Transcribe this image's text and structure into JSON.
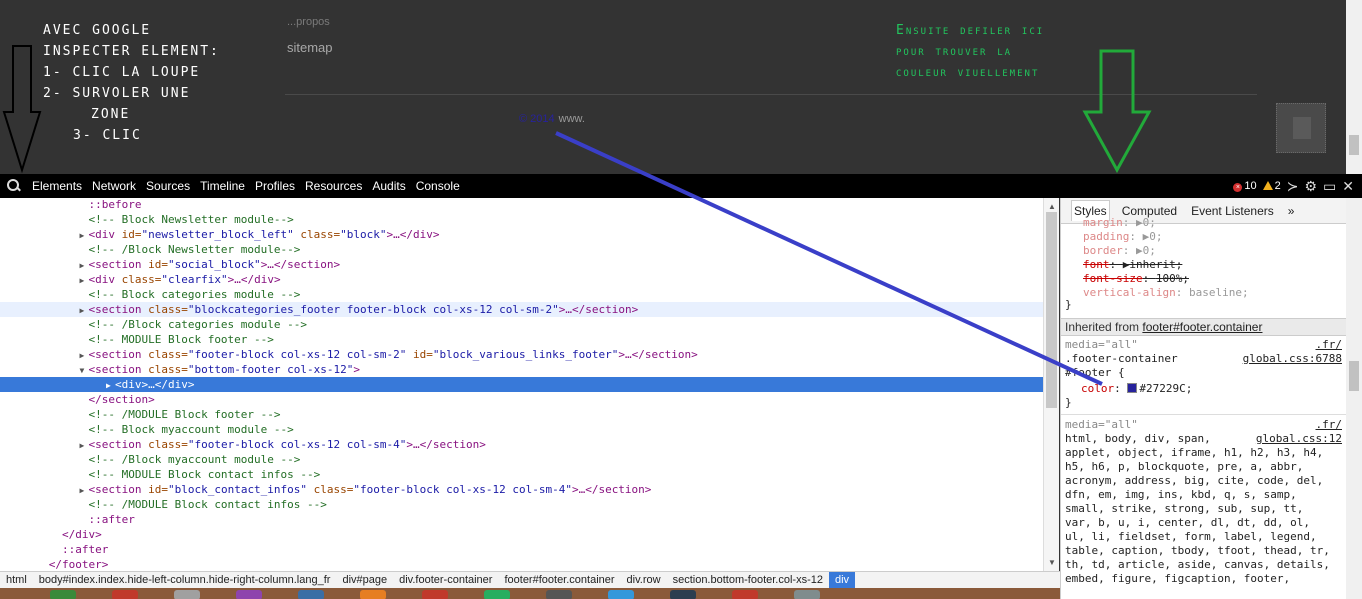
{
  "page": {
    "note_left": [
      "AVEC GOOGLE",
      "INSPECTER ELEMENT:",
      "1- CLIC LA LOUPE",
      "2- SURVOLER UNE",
      "ZONE",
      "3- CLIC"
    ],
    "note_right": [
      "Ensuite defiler ici",
      "pour trouver la",
      "couleur viuellement"
    ],
    "propos": "...propos",
    "sitemap": "sitemap",
    "copyright_symbol": "© 2014",
    "copyright_site": "www.",
    "annotation_colors": {
      "left_arrow": "#000000",
      "right_arrow": "#22aa3a",
      "pointer_line": "#3a3fc8"
    }
  },
  "toolbar": {
    "tabs": [
      "Elements",
      "Network",
      "Sources",
      "Timeline",
      "Profiles",
      "Resources",
      "Audits",
      "Console"
    ],
    "errors": "10",
    "warnings": "2",
    "icons": [
      "search-icon",
      "drawer-icon",
      "gear-icon",
      "dock-icon",
      "close-icon"
    ]
  },
  "elements": {
    "lines": [
      {
        "indent": 7,
        "tri": "",
        "parts": [
          [
            "pseudo",
            "::before"
          ]
        ]
      },
      {
        "indent": 7,
        "tri": "",
        "parts": [
          [
            "cmt",
            "<!-- Block Newsletter module-->"
          ]
        ]
      },
      {
        "indent": 7,
        "tri": "▶",
        "parts": [
          [
            "tag",
            "<div "
          ],
          [
            "attr",
            "id="
          ],
          [
            "val",
            "\"newsletter_block_left\""
          ],
          [
            "attr",
            " class="
          ],
          [
            "val",
            "\"block\""
          ],
          [
            "tag",
            ">…</div>"
          ]
        ]
      },
      {
        "indent": 7,
        "tri": "",
        "parts": [
          [
            "cmt",
            "<!-- /Block Newsletter module-->"
          ]
        ]
      },
      {
        "indent": 7,
        "tri": "▶",
        "parts": [
          [
            "tag",
            "<section "
          ],
          [
            "attr",
            "id="
          ],
          [
            "val",
            "\"social_block\""
          ],
          [
            "tag",
            ">…</section>"
          ]
        ]
      },
      {
        "indent": 7,
        "tri": "▶",
        "parts": [
          [
            "tag",
            "<div "
          ],
          [
            "attr",
            "class="
          ],
          [
            "val",
            "\"clearfix\""
          ],
          [
            "tag",
            ">…</div>"
          ]
        ]
      },
      {
        "indent": 7,
        "tri": "",
        "parts": [
          [
            "cmt",
            "<!-- Block categories module -->"
          ]
        ]
      },
      {
        "indent": 7,
        "tri": "▶",
        "parts": [
          [
            "tag",
            "<section "
          ],
          [
            "attr",
            "class="
          ],
          [
            "val",
            "\"blockcategories_footer footer-block col-xs-12 col-sm-2\""
          ],
          [
            "tag",
            ">…</section>"
          ]
        ],
        "hover": true
      },
      {
        "indent": 7,
        "tri": "",
        "parts": [
          [
            "cmt",
            "<!-- /Block categories module -->"
          ]
        ]
      },
      {
        "indent": 7,
        "tri": "",
        "parts": [
          [
            "cmt",
            "<!-- MODULE Block footer -->"
          ]
        ]
      },
      {
        "indent": 7,
        "tri": "▶",
        "parts": [
          [
            "tag",
            "<section "
          ],
          [
            "attr",
            "class="
          ],
          [
            "val",
            "\"footer-block col-xs-12 col-sm-2\""
          ],
          [
            "attr",
            " id="
          ],
          [
            "val",
            "\"block_various_links_footer\""
          ],
          [
            "tag",
            ">…</section>"
          ]
        ]
      },
      {
        "indent": 7,
        "tri": "▼",
        "parts": [
          [
            "tag",
            "<section "
          ],
          [
            "attr",
            "class="
          ],
          [
            "val",
            "\"bottom-footer col-xs-12\""
          ],
          [
            "tag",
            ">"
          ]
        ]
      },
      {
        "indent": 9,
        "tri": "▶",
        "parts": [
          [
            "tag",
            "<div>…</div>"
          ]
        ],
        "selected": true
      },
      {
        "indent": 7,
        "tri": "",
        "parts": [
          [
            "tag",
            "</section>"
          ]
        ]
      },
      {
        "indent": 7,
        "tri": "",
        "parts": [
          [
            "cmt",
            "<!-- /MODULE Block footer -->"
          ]
        ]
      },
      {
        "indent": 7,
        "tri": "",
        "parts": [
          [
            "cmt",
            "<!-- Block myaccount module -->"
          ]
        ]
      },
      {
        "indent": 7,
        "tri": "▶",
        "parts": [
          [
            "tag",
            "<section "
          ],
          [
            "attr",
            "class="
          ],
          [
            "val",
            "\"footer-block col-xs-12 col-sm-4\""
          ],
          [
            "tag",
            ">…</section>"
          ]
        ]
      },
      {
        "indent": 7,
        "tri": "",
        "parts": [
          [
            "cmt",
            "<!-- /Block myaccount module -->"
          ]
        ]
      },
      {
        "indent": 7,
        "tri": "",
        "parts": [
          [
            "cmt",
            "<!-- MODULE Block contact infos -->"
          ]
        ]
      },
      {
        "indent": 7,
        "tri": "▶",
        "parts": [
          [
            "tag",
            "<section "
          ],
          [
            "attr",
            "id="
          ],
          [
            "val",
            "\"block_contact_infos\""
          ],
          [
            "attr",
            " class="
          ],
          [
            "val",
            "\"footer-block col-xs-12 col-sm-4\""
          ],
          [
            "tag",
            ">…</section>"
          ]
        ]
      },
      {
        "indent": 7,
        "tri": "",
        "parts": [
          [
            "cmt",
            "<!-- /MODULE Block contact infos -->"
          ]
        ]
      },
      {
        "indent": 7,
        "tri": "",
        "parts": [
          [
            "pseudo",
            "::after"
          ]
        ]
      },
      {
        "indent": 5,
        "tri": "",
        "parts": [
          [
            "tag",
            "</div>"
          ]
        ]
      },
      {
        "indent": 5,
        "tri": "",
        "parts": [
          [
            "pseudo",
            "::after"
          ]
        ]
      },
      {
        "indent": 4,
        "tri": "",
        "parts": [
          [
            "tag",
            "</footer>"
          ]
        ]
      }
    ]
  },
  "styles": {
    "tabs": [
      "Styles",
      "Computed",
      "Event Listeners",
      "»"
    ],
    "prev_rule": [
      {
        "name": "margin",
        "value": "▶0;",
        "strike": false,
        "faded": true
      },
      {
        "name": "padding",
        "value": "▶0;",
        "strike": false,
        "faded": true
      },
      {
        "name": "border",
        "value": "▶0;",
        "strike": false,
        "faded": true
      },
      {
        "name": "font",
        "value": "▶inherit;",
        "strike": true,
        "faded": false
      },
      {
        "name": "font-size",
        "value": "100%;",
        "strike": true,
        "faded": false
      },
      {
        "name": "vertical-align",
        "value": "baseline;",
        "strike": false,
        "faded": true
      }
    ],
    "inherited_label": "Inherited from",
    "inherited_from": "footer#footer.container",
    "rule1": {
      "media": "media=\"all\"",
      "source_host": ".fr/",
      "selector": ".footer-container",
      "source": "global.css:6788",
      "selector2": "#footer {",
      "prop": "color",
      "value": "#27229C;",
      "swatch": "#27229C"
    },
    "rule2": {
      "media": "media=\"all\"",
      "source_host": ".fr/",
      "source": "global.css:12",
      "selectors": [
        "html, body, div, span,",
        "applet, object, iframe, h1, h2, h3, h4,",
        "h5, h6, p, blockquote, pre, a, abbr,",
        "acronym, address, big, cite, code, del,",
        "dfn, em, img, ins, kbd, q, s, samp,",
        "small, strike, strong, sub, sup, tt,",
        "var, b, u, i, center, dl, dt, dd, ol,",
        "ul, li, fieldset, form, label, legend,",
        "table, caption, tbody, tfoot, thead, tr,",
        "th, td, article, aside, canvas, details,",
        "embed, figure, figcaption, footer,"
      ]
    }
  },
  "breadcrumbs": [
    "html",
    "body#index.index.hide-left-column.hide-right-column.lang_fr",
    "div#page",
    "div.footer-container",
    "footer#footer.container",
    "div.row",
    "section.bottom-footer.col-xs-12",
    "div"
  ]
}
